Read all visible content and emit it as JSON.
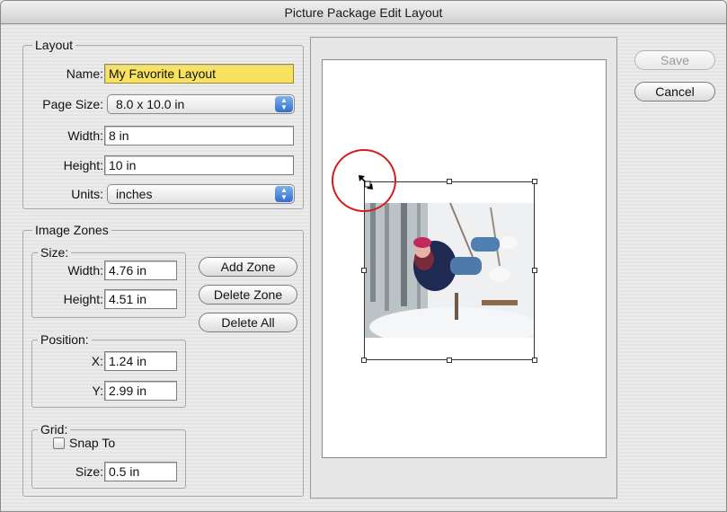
{
  "window": {
    "title": "Picture Package Edit Layout"
  },
  "layout": {
    "legend": "Layout",
    "name_label": "Name:",
    "name_value": "My Favorite Layout",
    "page_size_label": "Page Size:",
    "page_size_value": "8.0 x 10.0 in",
    "width_label": "Width:",
    "width_value": "8 in",
    "height_label": "Height:",
    "height_value": "10 in",
    "units_label": "Units:",
    "units_value": "inches"
  },
  "image_zones": {
    "legend": "Image Zones",
    "size": {
      "legend": "Size:",
      "width_label": "Width:",
      "width_value": "4.76 in",
      "height_label": "Height:",
      "height_value": "4.51 in"
    },
    "position": {
      "legend": "Position:",
      "x_label": "X:",
      "x_value": "1.24 in",
      "y_label": "Y:",
      "y_value": "2.99 in"
    },
    "grid": {
      "legend": "Grid:",
      "snap_label": "Snap To",
      "snap_checked": false,
      "size_label": "Size:",
      "size_value": "0.5 in"
    },
    "add_zone": "Add Zone",
    "delete_zone": "Delete Zone",
    "delete_all": "Delete All"
  },
  "buttons": {
    "save": "Save",
    "cancel": "Cancel"
  },
  "colors": {
    "name_highlight": "#f7e35f",
    "popup_accent": "#3a7bd5",
    "annotation_circle": "#d21d1d"
  },
  "icons": {
    "popup_arrows": "up-down-arrows-icon",
    "resize_cursor": "resize-cursor-icon"
  }
}
